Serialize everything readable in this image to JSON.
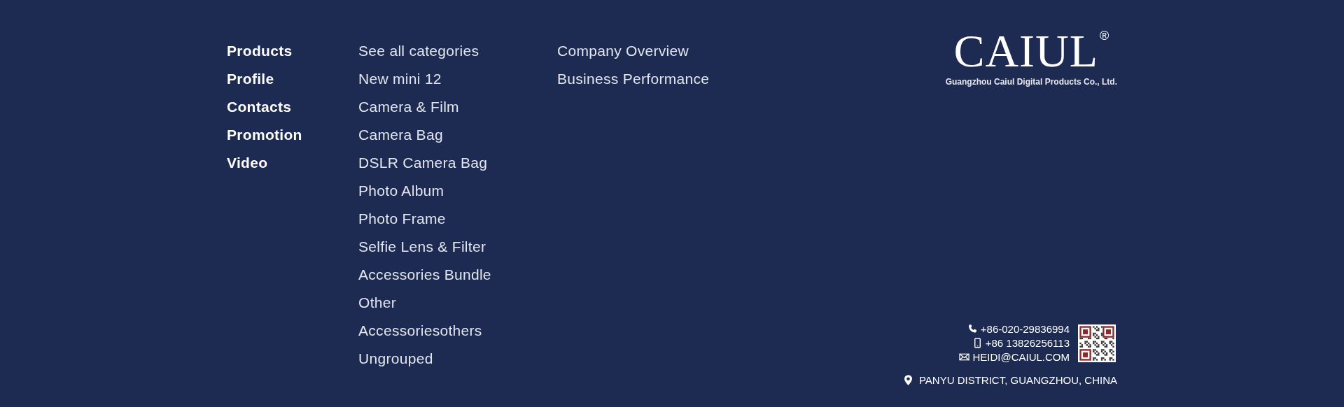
{
  "nav_main": [
    "Products",
    "Profile",
    "Contacts",
    "Promotion",
    "Video"
  ],
  "nav_categories": [
    "See all categories",
    "New mini 12",
    "Camera & Film",
    "Camera Bag",
    "DSLR Camera Bag",
    "Photo Album",
    "Photo Frame",
    "Selfie Lens & Filter",
    "Accessories Bundle",
    "Other",
    "Accessoriesothers",
    "Ungrouped"
  ],
  "nav_company": [
    "Company Overview",
    "Business Performance"
  ],
  "logo": {
    "text": "CAIUL",
    "mark": "®",
    "tagline": "Guangzhou Caiul Digital Products Co., Ltd."
  },
  "contacts": [
    {
      "kind": "phone",
      "text": "+86-020-29836994"
    },
    {
      "kind": "mobile",
      "text": "+86 13826256113"
    },
    {
      "kind": "email",
      "text": "HEIDI@CAIUL.COM"
    }
  ],
  "address": "PANYU DISTRICT, GUANGZHOU, CHINA"
}
